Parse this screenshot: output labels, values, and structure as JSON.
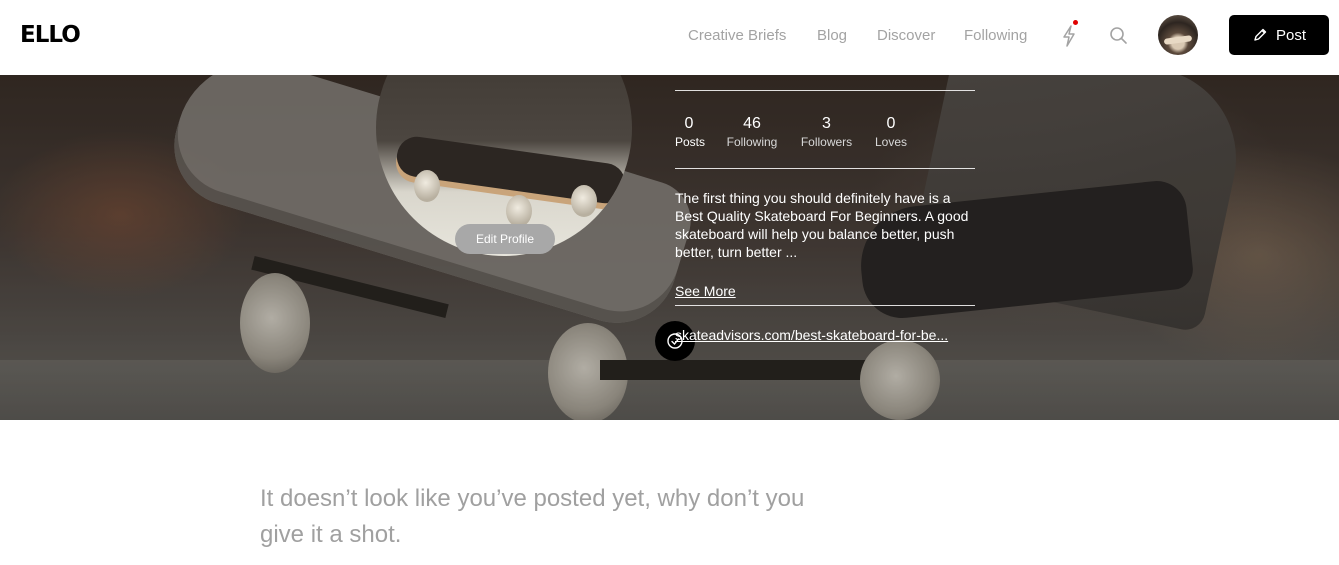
{
  "header": {
    "logo": "ELLO",
    "nav": [
      {
        "label": "Creative Briefs"
      },
      {
        "label": "Blog"
      },
      {
        "label": "Discover"
      },
      {
        "label": "Following"
      }
    ],
    "notification_dot_color": "#e00000",
    "post_label": "Post"
  },
  "profile": {
    "edit_label": "Edit Profile",
    "stats": [
      {
        "value": "0",
        "label": "Posts"
      },
      {
        "value": "46",
        "label": "Following"
      },
      {
        "value": "3",
        "label": "Followers"
      },
      {
        "value": "0",
        "label": "Loves"
      }
    ],
    "bio": "The first thing you should definitely have is a Best Quality Skateboard For Beginners. A good skateboard will help you balance better, push better, turn better ...",
    "see_more": "See More",
    "link": "skateadvisors.com/best-skateboard-for-be..."
  },
  "empty_state": "It doesn’t look like you’ve posted yet, why don’t you give it a shot."
}
